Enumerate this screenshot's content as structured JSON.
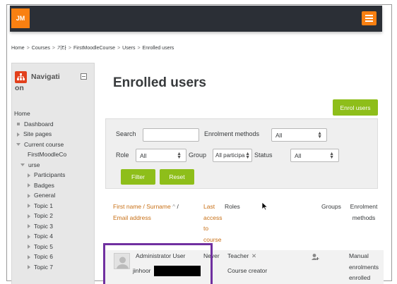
{
  "header": {
    "logo_text": "JM",
    "menu_icon": "hamburger-menu-icon"
  },
  "breadcrumb": [
    "Home",
    "Courses",
    "기타",
    "FirstMoodleCourse",
    "Users",
    "Enrolled users"
  ],
  "sidebar": {
    "title_line1": "Navigati",
    "title_line2": "on",
    "items": {
      "home": "Home",
      "dashboard": "Dashboard",
      "site_pages": "Site pages",
      "current_course": "Current course",
      "course_line1": "FirstMoodleCo",
      "course_line2": "urse",
      "participants": "Participants",
      "badges": "Badges",
      "general": "General",
      "topic1": "Topic 1",
      "topic2": "Topic 2",
      "topic3": "Topic 3",
      "topic4": "Topic 4",
      "topic5": "Topic 5",
      "topic6": "Topic 6",
      "topic7": "Topic 7"
    }
  },
  "main": {
    "title": "Enrolled users",
    "enrol_button": "Enrol users",
    "filter": {
      "search_label": "Search",
      "search_value": "",
      "methods_label": "Enrolment methods",
      "methods_value": "All",
      "role_label": "Role",
      "role_value": "All",
      "group_label": "Group",
      "group_value": "All participa",
      "status_label": "Status",
      "status_value": "All",
      "filter_button": "Filter",
      "reset_button": "Reset"
    },
    "table": {
      "col_name_1": "First name / Surname",
      "col_name_sort": "^",
      "col_name_sep": "/",
      "col_name_2": "Email address",
      "col_access": [
        "Last",
        "access",
        "to",
        "course"
      ],
      "col_roles": "Roles",
      "col_groups": "Groups",
      "col_enrol_1": "Enrolment",
      "col_enrol_2": "methods",
      "rows": [
        {
          "name": "Administrator User",
          "email_prefix": "jinhoor",
          "last_access": "Never",
          "role1": "Teacher",
          "role2": "Course creator",
          "enrol1": "Manual",
          "enrol2": "enrolments",
          "enrol3": "enrolled"
        }
      ]
    }
  },
  "colors": {
    "accent": "#f98012",
    "green": "#8ebe1a",
    "link": "#c87016",
    "highlight": "#7030a0",
    "navbar": "#2b2f36"
  }
}
